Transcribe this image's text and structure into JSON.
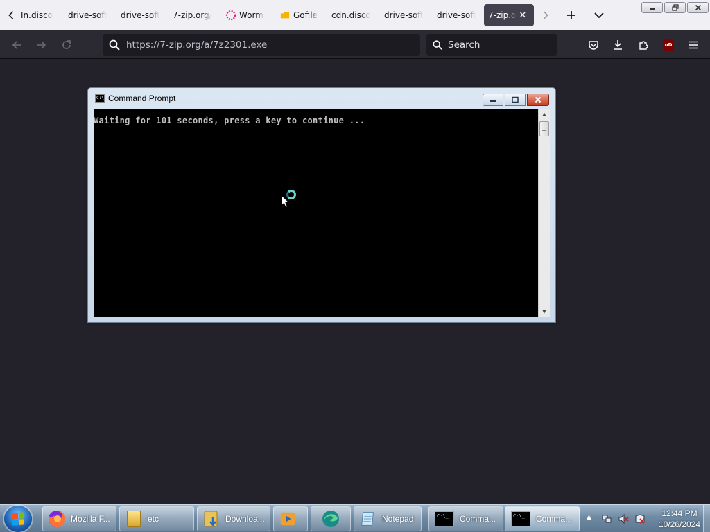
{
  "browser": {
    "tabs": [
      {
        "label": "In.disco",
        "favicon": "none"
      },
      {
        "label": "drive-soft",
        "favicon": "none"
      },
      {
        "label": "drive-soft",
        "favicon": "none"
      },
      {
        "label": "7-zip.org/",
        "favicon": "none"
      },
      {
        "label": "Worm",
        "favicon": "spinner-icon"
      },
      {
        "label": "Gofile",
        "favicon": "folder-icon"
      },
      {
        "label": "cdn.disco",
        "favicon": "none"
      },
      {
        "label": "drive-soft",
        "favicon": "none"
      },
      {
        "label": "drive-soft",
        "favicon": "none"
      },
      {
        "label": "7-zip.o",
        "favicon": "none",
        "active": true
      }
    ],
    "url": "https://7-zip.org/a/7z2301.exe",
    "search_placeholder": "Search",
    "extension_badge": "uD"
  },
  "cmd_window": {
    "title": "Command Prompt",
    "icon_text": "C:\\",
    "output_line": "Waiting for 101 seconds, press a key to continue ..."
  },
  "taskbar": {
    "buttons": [
      {
        "label": "Mozilla F...",
        "icon": "firefox-icon"
      },
      {
        "label": "etc",
        "icon": "folder-icon"
      },
      {
        "label": "Downloa...",
        "icon": "downloads-folder-icon"
      },
      {
        "label": "",
        "icon": "media-player-icon"
      },
      {
        "label": "",
        "icon": "edge-icon"
      },
      {
        "label": "Notepad",
        "icon": "notepad-icon"
      },
      {
        "label": "Comma...",
        "icon": "cmd-icon"
      },
      {
        "label": "Comma...",
        "icon": "cmd-icon",
        "active": true
      }
    ],
    "clock": {
      "time": "12:44 PM",
      "date": "10/26/2024"
    }
  },
  "colors": {
    "page_bg": "#23222b",
    "tabstrip_bg": "#f0f0f4",
    "navbar_bg": "#2b2a33",
    "active_tab_bg": "#42414d"
  }
}
